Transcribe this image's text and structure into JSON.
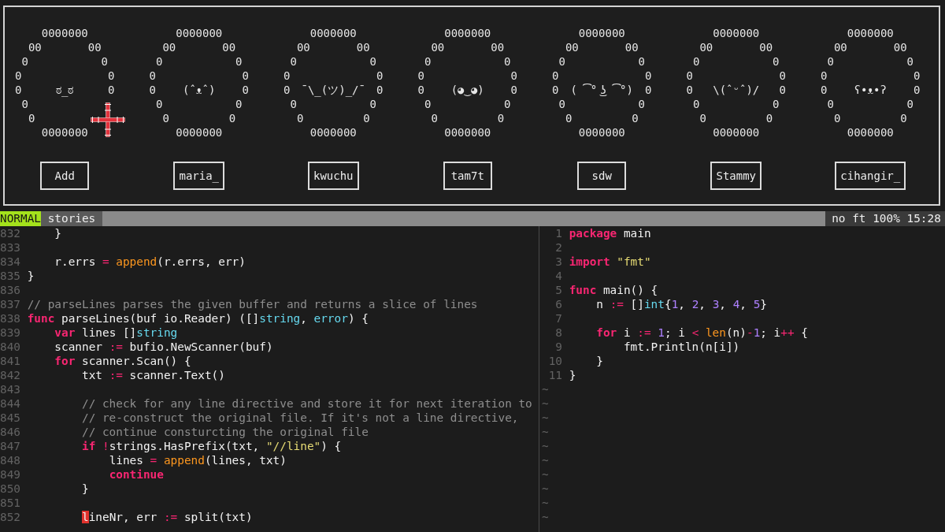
{
  "profile_panel": {
    "mouse_pointer": {
      "kind": "crosshair"
    },
    "profiles": [
      {
        "face": "ಠ_ಠ",
        "ring_rows": [
          [
            "0000000"
          ],
          [
            "00",
            "00"
          ],
          [
            "0",
            "0"
          ],
          [
            "0",
            "0"
          ],
          [
            "0",
            "0"
          ],
          [
            "0"
          ],
          [
            "0"
          ],
          [
            "0000000"
          ]
        ],
        "button": "Add"
      },
      {
        "face": "(ˆᴥˆ)",
        "ring_rows": [
          [
            "0000000"
          ],
          [
            "00",
            "00"
          ],
          [
            "0",
            "0"
          ],
          [
            "0",
            "0"
          ],
          [
            "0",
            "0"
          ],
          [
            "0",
            "0"
          ],
          [
            "0",
            "0"
          ],
          [
            "0000000"
          ]
        ],
        "button": "maria_"
      },
      {
        "face": "¯\\_(ツ)_/¯",
        "ring_rows": [
          [
            "0000000"
          ],
          [
            "00",
            "00"
          ],
          [
            "0",
            "0"
          ],
          [
            "0",
            "0"
          ],
          [
            "0",
            "0"
          ],
          [
            "0",
            "0"
          ],
          [
            "0",
            "0"
          ],
          [
            "0000000"
          ]
        ],
        "button": "kwuchu"
      },
      {
        "face": "(◕‿◕)",
        "ring_rows": [
          [
            "0000000"
          ],
          [
            "00",
            "00"
          ],
          [
            "0",
            "0"
          ],
          [
            "0",
            "0"
          ],
          [
            "0",
            "0"
          ],
          [
            "0",
            "0"
          ],
          [
            "0",
            "0"
          ],
          [
            "0000000"
          ]
        ],
        "button": "tam7t"
      },
      {
        "face": "( ͡° ͜ʖ ͡°)",
        "ring_rows": [
          [
            "0000000"
          ],
          [
            "00",
            "00"
          ],
          [
            "0",
            "0"
          ],
          [
            "0",
            "0"
          ],
          [
            "0",
            "0"
          ],
          [
            "0",
            "0"
          ],
          [
            "0",
            "0"
          ],
          [
            "0000000"
          ]
        ],
        "button": "sdw"
      },
      {
        "face": "\\(ˆᵕˆ)/",
        "ring_rows": [
          [
            "0000000"
          ],
          [
            "00",
            "00"
          ],
          [
            "0",
            "0"
          ],
          [
            "0",
            "0"
          ],
          [
            "0",
            "0"
          ],
          [
            "0",
            "0"
          ],
          [
            "0",
            "0"
          ],
          [
            "0000000"
          ]
        ],
        "button": "Stammy"
      },
      {
        "face": "ʕ•ᴥ•ʔ",
        "ring_rows": [
          [
            "0000000"
          ],
          [
            "00",
            "00"
          ],
          [
            "0",
            "0"
          ],
          [
            "0",
            "0"
          ],
          [
            "0",
            "0"
          ],
          [
            "0",
            "0"
          ],
          [
            "0",
            "0"
          ],
          [
            "0000000"
          ]
        ],
        "button": "cihangir_"
      }
    ]
  },
  "status_line": {
    "mode": "NORMAL",
    "file": "stories",
    "info": "no ft 100% 15:28"
  },
  "left_pane": {
    "lines": [
      {
        "number": "832",
        "code": [
          {
            "text": "    }",
            "kind": "plain"
          }
        ]
      },
      {
        "number": "833"
      },
      {
        "number": "834",
        "code": [
          {
            "text": "    r.errs ",
            "kind": "plain"
          },
          {
            "text": "= ",
            "kind": "operator"
          },
          {
            "text": "append",
            "kind": "builtin"
          },
          {
            "text": "(r.errs, err)",
            "kind": "plain"
          }
        ]
      },
      {
        "number": "835",
        "code": [
          {
            "text": "}",
            "kind": "plain"
          }
        ]
      },
      {
        "number": "836"
      },
      {
        "number": "837",
        "code": [
          {
            "text": "// parseLines parses the given buffer and returns a slice of lines",
            "kind": "comment"
          }
        ]
      },
      {
        "number": "838",
        "code": [
          {
            "text": "func",
            "kind": "keyword"
          },
          {
            "text": " parseLines(buf io.Reader) ([]",
            "kind": "plain"
          },
          {
            "text": "string",
            "kind": "type"
          },
          {
            "text": ", ",
            "kind": "plain"
          },
          {
            "text": "error",
            "kind": "type"
          },
          {
            "text": ") {",
            "kind": "plain"
          }
        ]
      },
      {
        "number": "839",
        "code": [
          {
            "text": "    var",
            "kind": "keyword"
          },
          {
            "text": " lines []",
            "kind": "plain"
          },
          {
            "text": "string",
            "kind": "type"
          }
        ]
      },
      {
        "number": "840",
        "code": [
          {
            "text": "    scanner ",
            "kind": "plain"
          },
          {
            "text": ":=",
            "kind": "operator"
          },
          {
            "text": " bufio.NewScanner(buf)",
            "kind": "plain"
          }
        ]
      },
      {
        "number": "841",
        "code": [
          {
            "text": "    for",
            "kind": "keyword"
          },
          {
            "text": " scanner.Scan() {",
            "kind": "plain"
          }
        ]
      },
      {
        "number": "842",
        "code": [
          {
            "text": "        txt ",
            "kind": "plain"
          },
          {
            "text": ":=",
            "kind": "operator"
          },
          {
            "text": " scanner.Text()",
            "kind": "plain"
          }
        ]
      },
      {
        "number": "843"
      },
      {
        "number": "844",
        "code": [
          {
            "text": "        // check for any line directive and store it for next iteration to",
            "kind": "comment"
          }
        ]
      },
      {
        "number": "845",
        "code": [
          {
            "text": "        // re-construct the original file. If it's not a line directive,",
            "kind": "comment"
          }
        ]
      },
      {
        "number": "846",
        "code": [
          {
            "text": "        // continue consturcting the original file",
            "kind": "comment"
          }
        ]
      },
      {
        "number": "847",
        "code": [
          {
            "text": "        if ",
            "kind": "keyword"
          },
          {
            "text": "!",
            "kind": "operator"
          },
          {
            "text": "strings.HasPrefix(txt, ",
            "kind": "plain"
          },
          {
            "text": "\"//line\"",
            "kind": "string"
          },
          {
            "text": ") {",
            "kind": "plain"
          }
        ]
      },
      {
        "number": "848",
        "code": [
          {
            "text": "            lines ",
            "kind": "plain"
          },
          {
            "text": "= ",
            "kind": "operator"
          },
          {
            "text": "append",
            "kind": "builtin"
          },
          {
            "text": "(lines, txt)",
            "kind": "plain"
          }
        ]
      },
      {
        "number": "849",
        "code": [
          {
            "text": "            continue",
            "kind": "keyword"
          }
        ]
      },
      {
        "number": "850",
        "code": [
          {
            "text": "        }",
            "kind": "plain"
          }
        ]
      },
      {
        "number": "851"
      },
      {
        "number": "852",
        "code": [
          {
            "text": "        l",
            "kind": "cursor"
          },
          {
            "text": "ineNr, err ",
            "kind": "plain"
          },
          {
            "text": ":=",
            "kind": "operator"
          },
          {
            "text": " split(txt)",
            "kind": "plain"
          }
        ]
      }
    ]
  },
  "right_pane": {
    "lines": [
      {
        "number": "1",
        "code": [
          {
            "text": "package",
            "kind": "keyword"
          },
          {
            "text": " main",
            "kind": "plain"
          }
        ]
      },
      {
        "number": "2"
      },
      {
        "number": "3",
        "code": [
          {
            "text": "import ",
            "kind": "keyword"
          },
          {
            "text": "\"fmt\"",
            "kind": "string"
          }
        ]
      },
      {
        "number": "4"
      },
      {
        "number": "5",
        "code": [
          {
            "text": "func",
            "kind": "keyword"
          },
          {
            "text": " main() {",
            "kind": "plain"
          }
        ]
      },
      {
        "number": "6",
        "code": [
          {
            "text": "    n ",
            "kind": "plain"
          },
          {
            "text": ":=",
            "kind": "operator"
          },
          {
            "text": " []",
            "kind": "plain"
          },
          {
            "text": "int",
            "kind": "type"
          },
          {
            "text": "{",
            "kind": "plain"
          },
          {
            "text": "1",
            "kind": "number"
          },
          {
            "text": ", ",
            "kind": "plain"
          },
          {
            "text": "2",
            "kind": "number"
          },
          {
            "text": ", ",
            "kind": "plain"
          },
          {
            "text": "3",
            "kind": "number"
          },
          {
            "text": ", ",
            "kind": "plain"
          },
          {
            "text": "4",
            "kind": "number"
          },
          {
            "text": ", ",
            "kind": "plain"
          },
          {
            "text": "5",
            "kind": "number"
          },
          {
            "text": "}",
            "kind": "plain"
          }
        ]
      },
      {
        "number": "7"
      },
      {
        "number": "8",
        "code": [
          {
            "text": "    for",
            "kind": "keyword"
          },
          {
            "text": " i ",
            "kind": "plain"
          },
          {
            "text": ":= ",
            "kind": "operator"
          },
          {
            "text": "1",
            "kind": "number"
          },
          {
            "text": "; i ",
            "kind": "plain"
          },
          {
            "text": "< ",
            "kind": "operator"
          },
          {
            "text": "len",
            "kind": "builtin"
          },
          {
            "text": "(n)",
            "kind": "plain"
          },
          {
            "text": "-",
            "kind": "operator"
          },
          {
            "text": "1",
            "kind": "number"
          },
          {
            "text": "; i",
            "kind": "plain"
          },
          {
            "text": "++",
            "kind": "operator"
          },
          {
            "text": " {",
            "kind": "plain"
          }
        ]
      },
      {
        "number": "9",
        "code": [
          {
            "text": "        fmt.Println(n[i])",
            "kind": "plain"
          }
        ]
      },
      {
        "number": "10",
        "code": [
          {
            "text": "    }",
            "kind": "plain"
          }
        ]
      },
      {
        "number": "11",
        "code": [
          {
            "text": "}",
            "kind": "plain"
          }
        ]
      }
    ],
    "end_of_buffer": [
      "~",
      "~",
      "~",
      "~",
      "~",
      "~",
      "~",
      "~",
      "~",
      "~"
    ]
  }
}
